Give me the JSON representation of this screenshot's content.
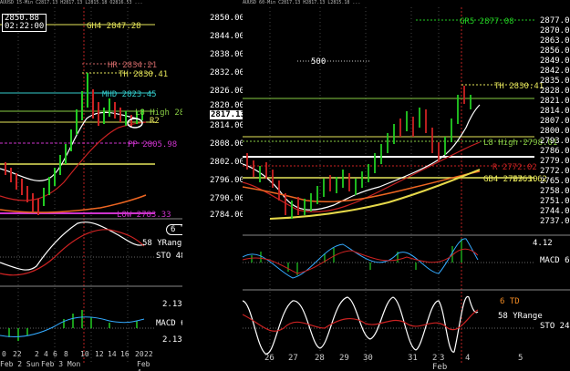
{
  "left_chart": {
    "header": "AUUSD 15-Min C2817.13 H2817.13 L2815.18 O2816.53 ...",
    "box_price": "2850.88",
    "box_time": "02:22:00",
    "price_labels": [
      "2850.00",
      "2844.00",
      "2838.00",
      "2832.00",
      "2826.00",
      "2820.00",
      "2817.13",
      "2814.00",
      "2808.00",
      "2802.00",
      "2796.00",
      "2790.00",
      "2784.00"
    ],
    "level_labels": [
      "GH4 2847.28",
      "HR 2834.21",
      "TH 2830.41",
      "MHD 2823.45",
      "L8 High 2818.42",
      "R2",
      "PP 2805.98",
      "LOW 2783.33"
    ],
    "stoch_label": "STO 48",
    "macd_label": "MACD 6",
    "td_badge": "6 TD",
    "yrange_label": "58 YRange",
    "macd_ticks": [
      "2.13",
      "2.13"
    ],
    "time_labels": [
      "0",
      "22",
      "2",
      "4",
      "6",
      "8",
      "10",
      "12",
      "14",
      "16",
      "20",
      "22"
    ],
    "date_labels": [
      "Feb 2 Sun",
      "Feb 3 Mon",
      "Feb 4 Tue"
    ]
  },
  "right_chart": {
    "header": "AUUSD 60-Min C2817.13 H2817.13 L2815.18 ...",
    "price_labels": [
      "2877.00",
      "2870.00",
      "2863.00",
      "2856.00",
      "2849.00",
      "2842.00",
      "2835.00",
      "2828.00",
      "2821.00",
      "2814.00",
      "2807.00",
      "2800.00",
      "2793.00",
      "2786.00",
      "2779.00",
      "2772.00",
      "2765.00",
      "2758.00",
      "2751.00",
      "2744.00",
      "2737.00"
    ],
    "level_labels": [
      "GR5 2877.08",
      "500",
      "TH 2830.41",
      "L8 High 2798.01",
      "R 2772.02",
      "GB4 2763.10",
      "2763.62"
    ],
    "stoch_label": "STO 24",
    "macd_label": "MACD 6",
    "td_badge": "6 TD",
    "yrange_label": "58 YRange",
    "macd_tick": "4.12",
    "time_labels": [
      "26",
      "27",
      "28",
      "29",
      "30",
      "31",
      "2",
      "3",
      "4",
      "5"
    ],
    "date_label": "Feb"
  },
  "colors": {
    "up_candle": "#22cc22",
    "down_candle": "#cc2222",
    "ma_white": "#ffffff",
    "ma_orange": "#ee6622",
    "ma_red": "#cc2222",
    "level_yellow": "#e6e65a",
    "level_cyan": "#33cccc",
    "level_magenta": "#cc33cc",
    "level_green": "#88cc44"
  }
}
